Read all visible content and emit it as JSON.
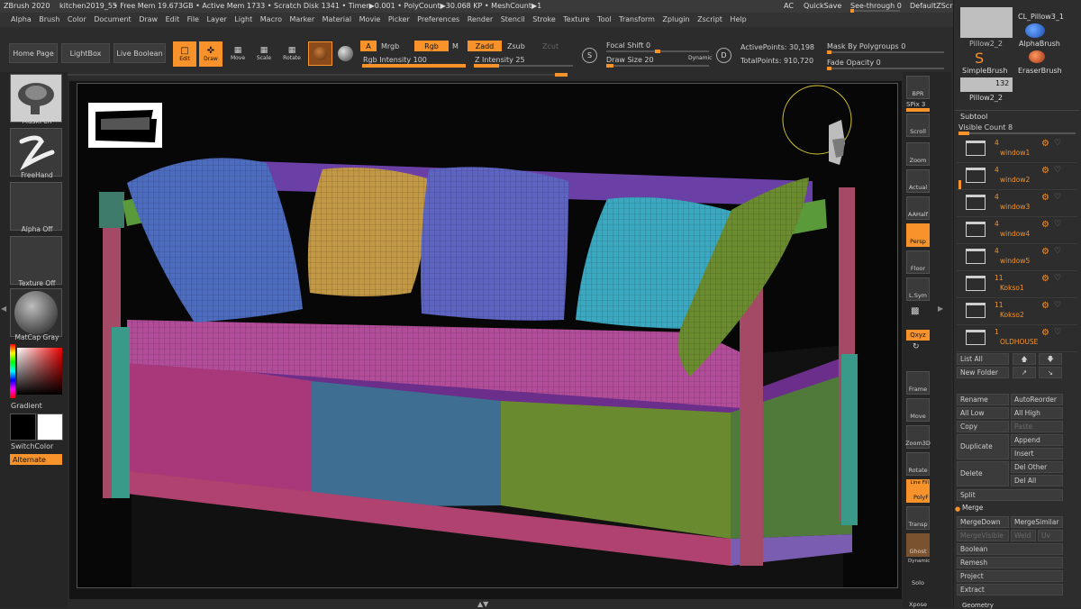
{
  "title_bar": {
    "app": "ZBrush 2020",
    "document": "kitchen2019_55",
    "stats": "• Free Mem 19.673GB • Active Mem 1733 • Scratch Disk 1341 •  Timer▶0.001 • PolyCount▶30.068 KP • MeshCount▶1",
    "ac": "AC",
    "quicksave": "QuickSave",
    "seethrough": "See-through  0",
    "zscript": "DefaultZScript"
  },
  "menu": [
    "Alpha",
    "Brush",
    "Color",
    "Document",
    "Draw",
    "Edit",
    "File",
    "Layer",
    "Light",
    "Macro",
    "Marker",
    "Material",
    "Movie",
    "Picker",
    "Preferences",
    "Render",
    "Stencil",
    "Stroke",
    "Texture",
    "Tool",
    "Transform",
    "Zplugin",
    "Zscript",
    "Help"
  ],
  "toolbar": {
    "home_page": "Home Page",
    "lightbox": "LightBox",
    "live_boolean": "Live Boolean",
    "edit": "Edit",
    "draw": "Draw",
    "move": "Move",
    "scale": "Scale",
    "rotate": "Rotate",
    "a": "A",
    "mrgb": "Mrgb",
    "rgb": "Rgb",
    "m": "M",
    "zadd": "Zadd",
    "zsub": "Zsub",
    "zcut": "Zcut",
    "rgb_intensity": "Rgb Intensity 100",
    "rgb_intensity_value": 100,
    "z_intensity": "Z Intensity 25",
    "z_intensity_value": 25,
    "focal_shift": "Focal Shift 0",
    "draw_size": "Draw Size 20",
    "dynamic": "Dynamic",
    "s_key": "S",
    "d_key": "D",
    "active_points": "ActivePoints: 30,198",
    "total_points": "TotalPoints: 910,720",
    "mask_by_polygroups": "Mask By Polygroups 0",
    "fade_opacity": "Fade Opacity 0"
  },
  "left_shelf": {
    "maskpen": "MaskPen",
    "freehand": "FreeHand",
    "alpha_off": "Alpha Off",
    "texture_off": "Texture Off",
    "matcap_gray": "MatCap Gray",
    "gradient": "Gradient",
    "switch_color": "SwitchColor",
    "alternate": "Alternate"
  },
  "right_shelf": {
    "bpr": "BPR",
    "spix": "SPix 3",
    "scroll": "Scroll",
    "zoom": "Zoom",
    "actual": "Actual",
    "aahalf": "AAHalf",
    "persp": "Persp",
    "floor": "Floor",
    "lsym": "L.Sym",
    "xyz": "Qxyz",
    "frame": "Frame",
    "move": "Move",
    "zoom3d": "Zoom3D",
    "rotate": "Rotate",
    "line_fill": "Line Fill",
    "polyf": "PolyF",
    "transp": "Transp",
    "ghost": "Ghost",
    "dynamic": "Dynamic",
    "solo": "Solo",
    "xpose": "Xpose"
  },
  "right_panel": {
    "tools": {
      "pillow_top": "Pillow2_2",
      "cl_pillow": "CL_Pillow3_1",
      "alphabrush": "AlphaBrush",
      "simplebrush": "SimpleBrush",
      "eraserbrush": "EraserBrush",
      "pillow_bottom": "Pillow2_2",
      "pillow_count": "132"
    },
    "subtool_header": "Subtool",
    "visible_count": "Visible Count 8",
    "subtools": [
      {
        "count": "4",
        "name": "window1"
      },
      {
        "count": "4",
        "name": "window2"
      },
      {
        "count": "4",
        "name": "window3"
      },
      {
        "count": "4",
        "name": "window4"
      },
      {
        "count": "4",
        "name": "window5"
      },
      {
        "count": "11",
        "name": "Kokso1"
      },
      {
        "count": "11",
        "name": "Kokso2"
      },
      {
        "count": "1",
        "name": "OLDHOUSE"
      }
    ],
    "buttons": {
      "list_all": "List All",
      "new_folder": "New Folder",
      "rename": "Rename",
      "autoreorder": "AutoReorder",
      "all_low": "All Low",
      "all_high": "All High",
      "copy": "Copy",
      "paste": "Paste",
      "duplicate": "Duplicate",
      "append": "Append",
      "insert": "Insert",
      "delete": "Delete",
      "del_other": "Del Other",
      "del_all": "Del All",
      "split": "Split",
      "merge": "Merge",
      "mergedown": "MergeDown",
      "mergesimilar": "MergeSimilar",
      "mergevisible": "MergeVisible",
      "weld": "Weld",
      "uv": "Uv",
      "boolean": "Boolean",
      "remesh": "Remesh",
      "project": "Project",
      "extract": "Extract",
      "geometry": "Geometry"
    }
  },
  "colors": {
    "accent": "#f7932a",
    "panel": "#2d2d2d",
    "canvas": "#070707"
  }
}
